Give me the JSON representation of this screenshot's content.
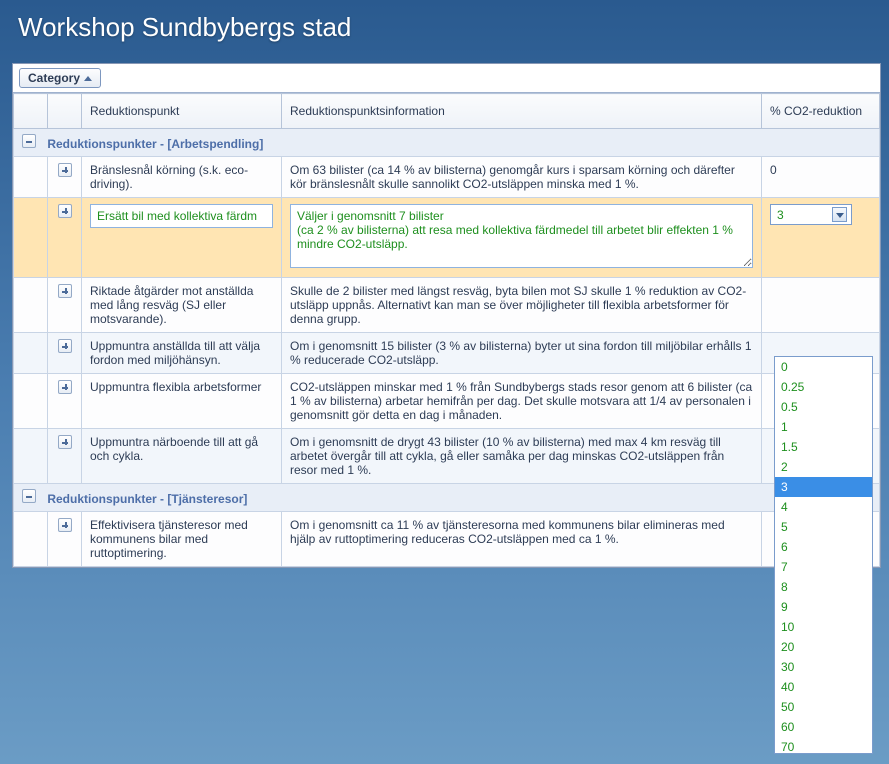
{
  "page_title": "Workshop Sundbybergs stad",
  "grouping_chip": "Category",
  "columns": {
    "reduction_point": "Reduktionspunkt",
    "reduction_info": "Reduktionspunktsinformation",
    "pct_co2": "% CO2-reduktion"
  },
  "groups": [
    {
      "title": "Reduktionspunkter - [Arbetspendling]",
      "rows": [
        {
          "point": "Bränslesnål körning (s.k. eco-driving).",
          "info": "Om 63 bilister (ca 14 % av bilisterna) genomgår kurs i sparsam körning och därefter kör bränslesnålt skulle sannolikt CO2-utsläppen minska med 1 %.",
          "pct": "0",
          "active": false
        },
        {
          "point": "Ersätt bil med kollektiva färdm",
          "info": "Väljer i genomsnitt 7 bilister\n(ca 2 % av bilisterna) att resa med kollektiva färdmedel till arbetet blir effekten 1 % mindre CO2-utsläpp.",
          "pct": "3",
          "active": true
        },
        {
          "point": "Riktade åtgärder mot anställda med lång resväg (SJ eller motsvarande).",
          "info": "Skulle de 2 bilister med längst resväg, byta bilen mot SJ skulle 1 % reduktion av CO2-utsläpp uppnås. Alternativt kan man se över möjligheter till flexibla arbetsformer för denna grupp.",
          "pct": "",
          "active": false
        },
        {
          "point": "Uppmuntra anställda till att välja fordon med miljöhänsyn.",
          "info": "Om i genomsnitt 15 bilister (3 % av bilisterna) byter ut sina fordon till miljöbilar erhålls 1 % reducerade CO2-utsläpp.",
          "pct": "",
          "active": false
        },
        {
          "point": "Uppmuntra flexibla arbetsformer",
          "info": "CO2-utsläppen minskar med 1 % från Sundbybergs stads resor genom att 6 bilister (ca 1 % av bilisterna) arbetar hemifrån per dag. Det skulle motsvara att 1/4 av personalen i genomsnitt gör detta en dag i månaden.",
          "pct": "",
          "active": false
        },
        {
          "point": "Uppmuntra närboende till att gå och cykla.",
          "info": "Om i genomsnitt de drygt 43 bilister (10 % av bilisterna) med max 4 km resväg till arbetet övergår till att cykla, gå eller samåka per dag minskas CO2-utsläppen från resor med 1 %.",
          "pct": "",
          "active": false
        }
      ]
    },
    {
      "title": "Reduktionspunkter - [Tjänsteresor]",
      "rows": [
        {
          "point": "Effektivisera tjänsteresor med kommunens bilar med ruttoptimering.",
          "info": "Om i genomsnitt ca 11 % av tjänsteresorna med kommunens bilar elimineras med hjälp av ruttoptimering reduceras CO2-utsläppen med ca 1 %.",
          "pct": "",
          "active": false
        }
      ]
    }
  ],
  "dropdown": {
    "selected_value": "3",
    "options": [
      "0",
      "0.25",
      "0.5",
      "1",
      "1.5",
      "2",
      "3",
      "4",
      "5",
      "6",
      "7",
      "8",
      "9",
      "10",
      "20",
      "30",
      "40",
      "50",
      "60",
      "70"
    ]
  }
}
